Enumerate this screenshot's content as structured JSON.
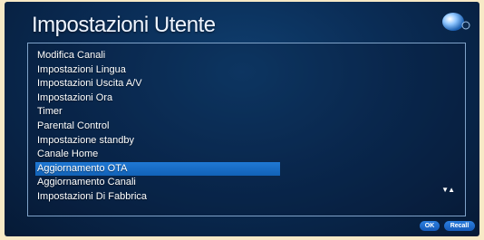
{
  "header": {
    "title": "Impostazioni Utente",
    "logo_icon": "globe-logo-icon"
  },
  "menu": {
    "items": [
      "Modifica Canali",
      "Impostazioni Lingua",
      "Impostazioni Uscita A/V",
      "Impostazioni Ora",
      "Timer",
      "Parental Control",
      "Impostazione standby",
      "Canale Home",
      "Aggiornamento OTA",
      "Aggiornamento Canali",
      "Impostazioni Di Fabbrica"
    ],
    "selected_index": 8,
    "scroll_indicator": "▼▲"
  },
  "footer": {
    "ok_label": "OK",
    "recall_label": "Recall"
  },
  "colors": {
    "background": "#0a2c55",
    "selection": "#1a6fcc",
    "panel_border": "#7fa2c8",
    "page_margin": "#f7e9c6"
  }
}
